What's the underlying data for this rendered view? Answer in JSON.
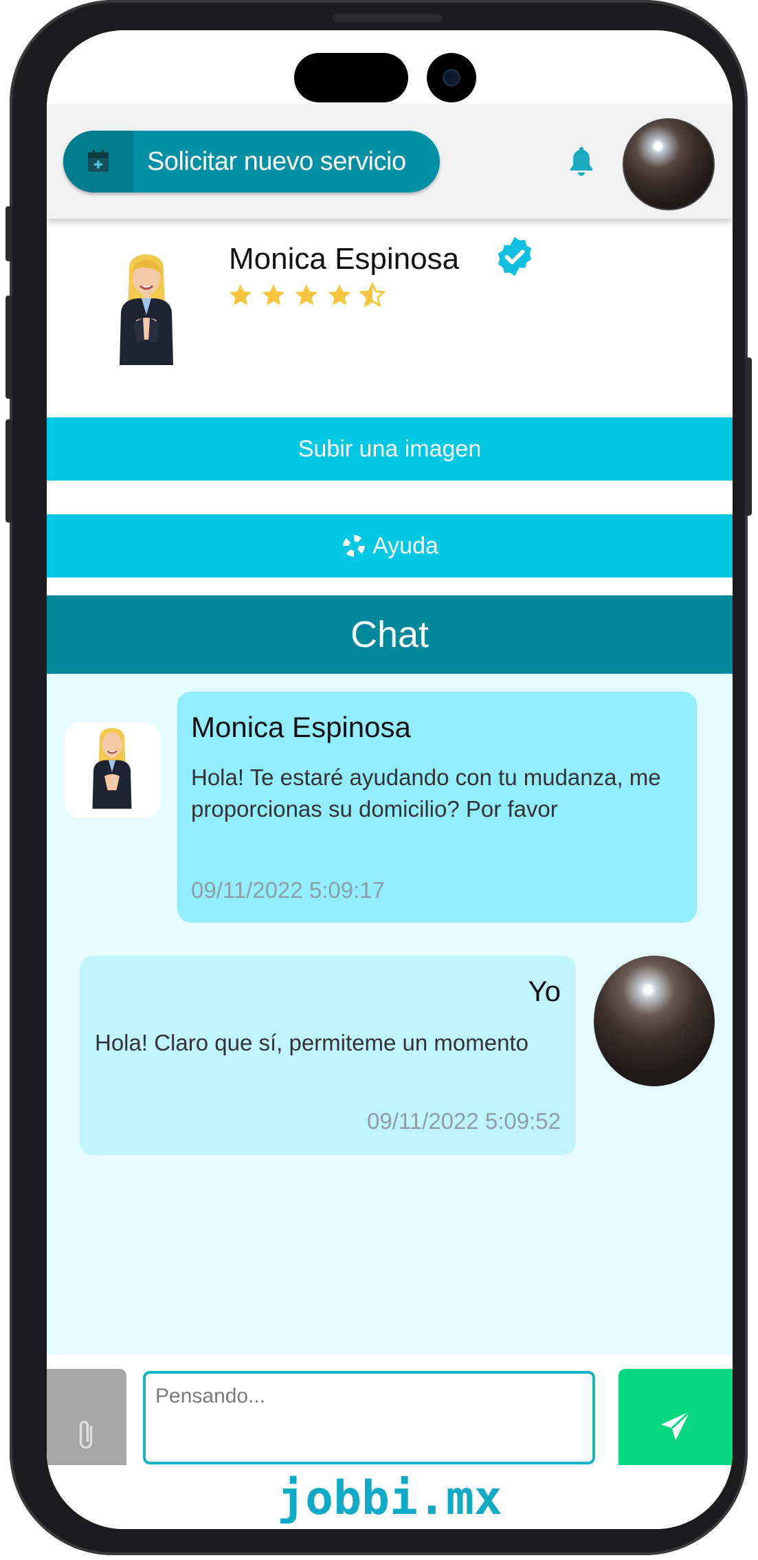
{
  "colors": {
    "accent": "#00c8e2",
    "accent_dark": "#00889b",
    "service_button": "#008fa3",
    "incoming_bubble": "#92edff",
    "outgoing_bubble": "#bff4ff",
    "chat_background": "#e4fbff",
    "send_button": "#07d880",
    "star": "#f7c63f",
    "brand": "#10a9c6"
  },
  "topbar": {
    "new_service_label": "Solicitar nuevo servicio",
    "new_service_icon": "calendar-plus-icon",
    "bell_icon": "bell-icon"
  },
  "profile": {
    "name": "Monica Espinosa",
    "verified_icon": "verified-badge-icon",
    "rating": 4.5,
    "rating_max": 5
  },
  "actions": {
    "upload_label": "Subir una imagen",
    "help_label": "Ayuda",
    "help_icon": "lifebuoy-icon"
  },
  "chat": {
    "title": "Chat",
    "messages": [
      {
        "sender": "Monica Espinosa",
        "text": "Hola! Te estaré ayudando con tu mudanza, me proporcionas su domicilio? Por favor",
        "time": "09/11/2022 5:09:17"
      },
      {
        "sender": "Yo",
        "text": "Hola! Claro que sí, permiteme un momento",
        "time": "09/11/2022 5:09:52"
      }
    ]
  },
  "composer": {
    "placeholder": "Pensando...",
    "attach_icon": "paperclip-icon",
    "send_icon": "send-icon"
  },
  "brand": {
    "text": "jobbi.mx"
  }
}
